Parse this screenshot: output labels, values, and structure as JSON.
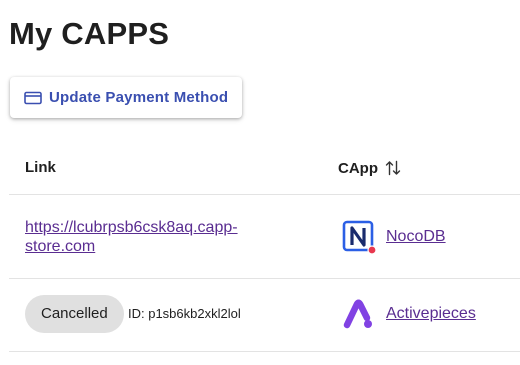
{
  "page": {
    "title": "My CAPPS"
  },
  "toolbar": {
    "update_payment_label": "Update Payment Method",
    "update_payment_icon": "credit-card-icon"
  },
  "table": {
    "columns": {
      "link": "Link",
      "capp": "CApp"
    },
    "sort_icon": "sort-arrows-icon",
    "rows": [
      {
        "link": "https://lcubrpsb6csk8aq.capp-store.com",
        "capp": "NocoDB",
        "logo": "nocodb-logo",
        "status_dot_color": "#e8384f"
      },
      {
        "status": "Cancelled",
        "id": "ID: p1sb6kb2xkl2lol",
        "capp": "Activepieces",
        "logo": "activepieces-logo"
      }
    ]
  },
  "colors": {
    "accent": "#3a4fb0",
    "link": "#5a2d91",
    "chip_bg": "#e0e0e0",
    "nocodb_blue": "#2b5fe5",
    "activepieces_purple": "#8142e3"
  }
}
